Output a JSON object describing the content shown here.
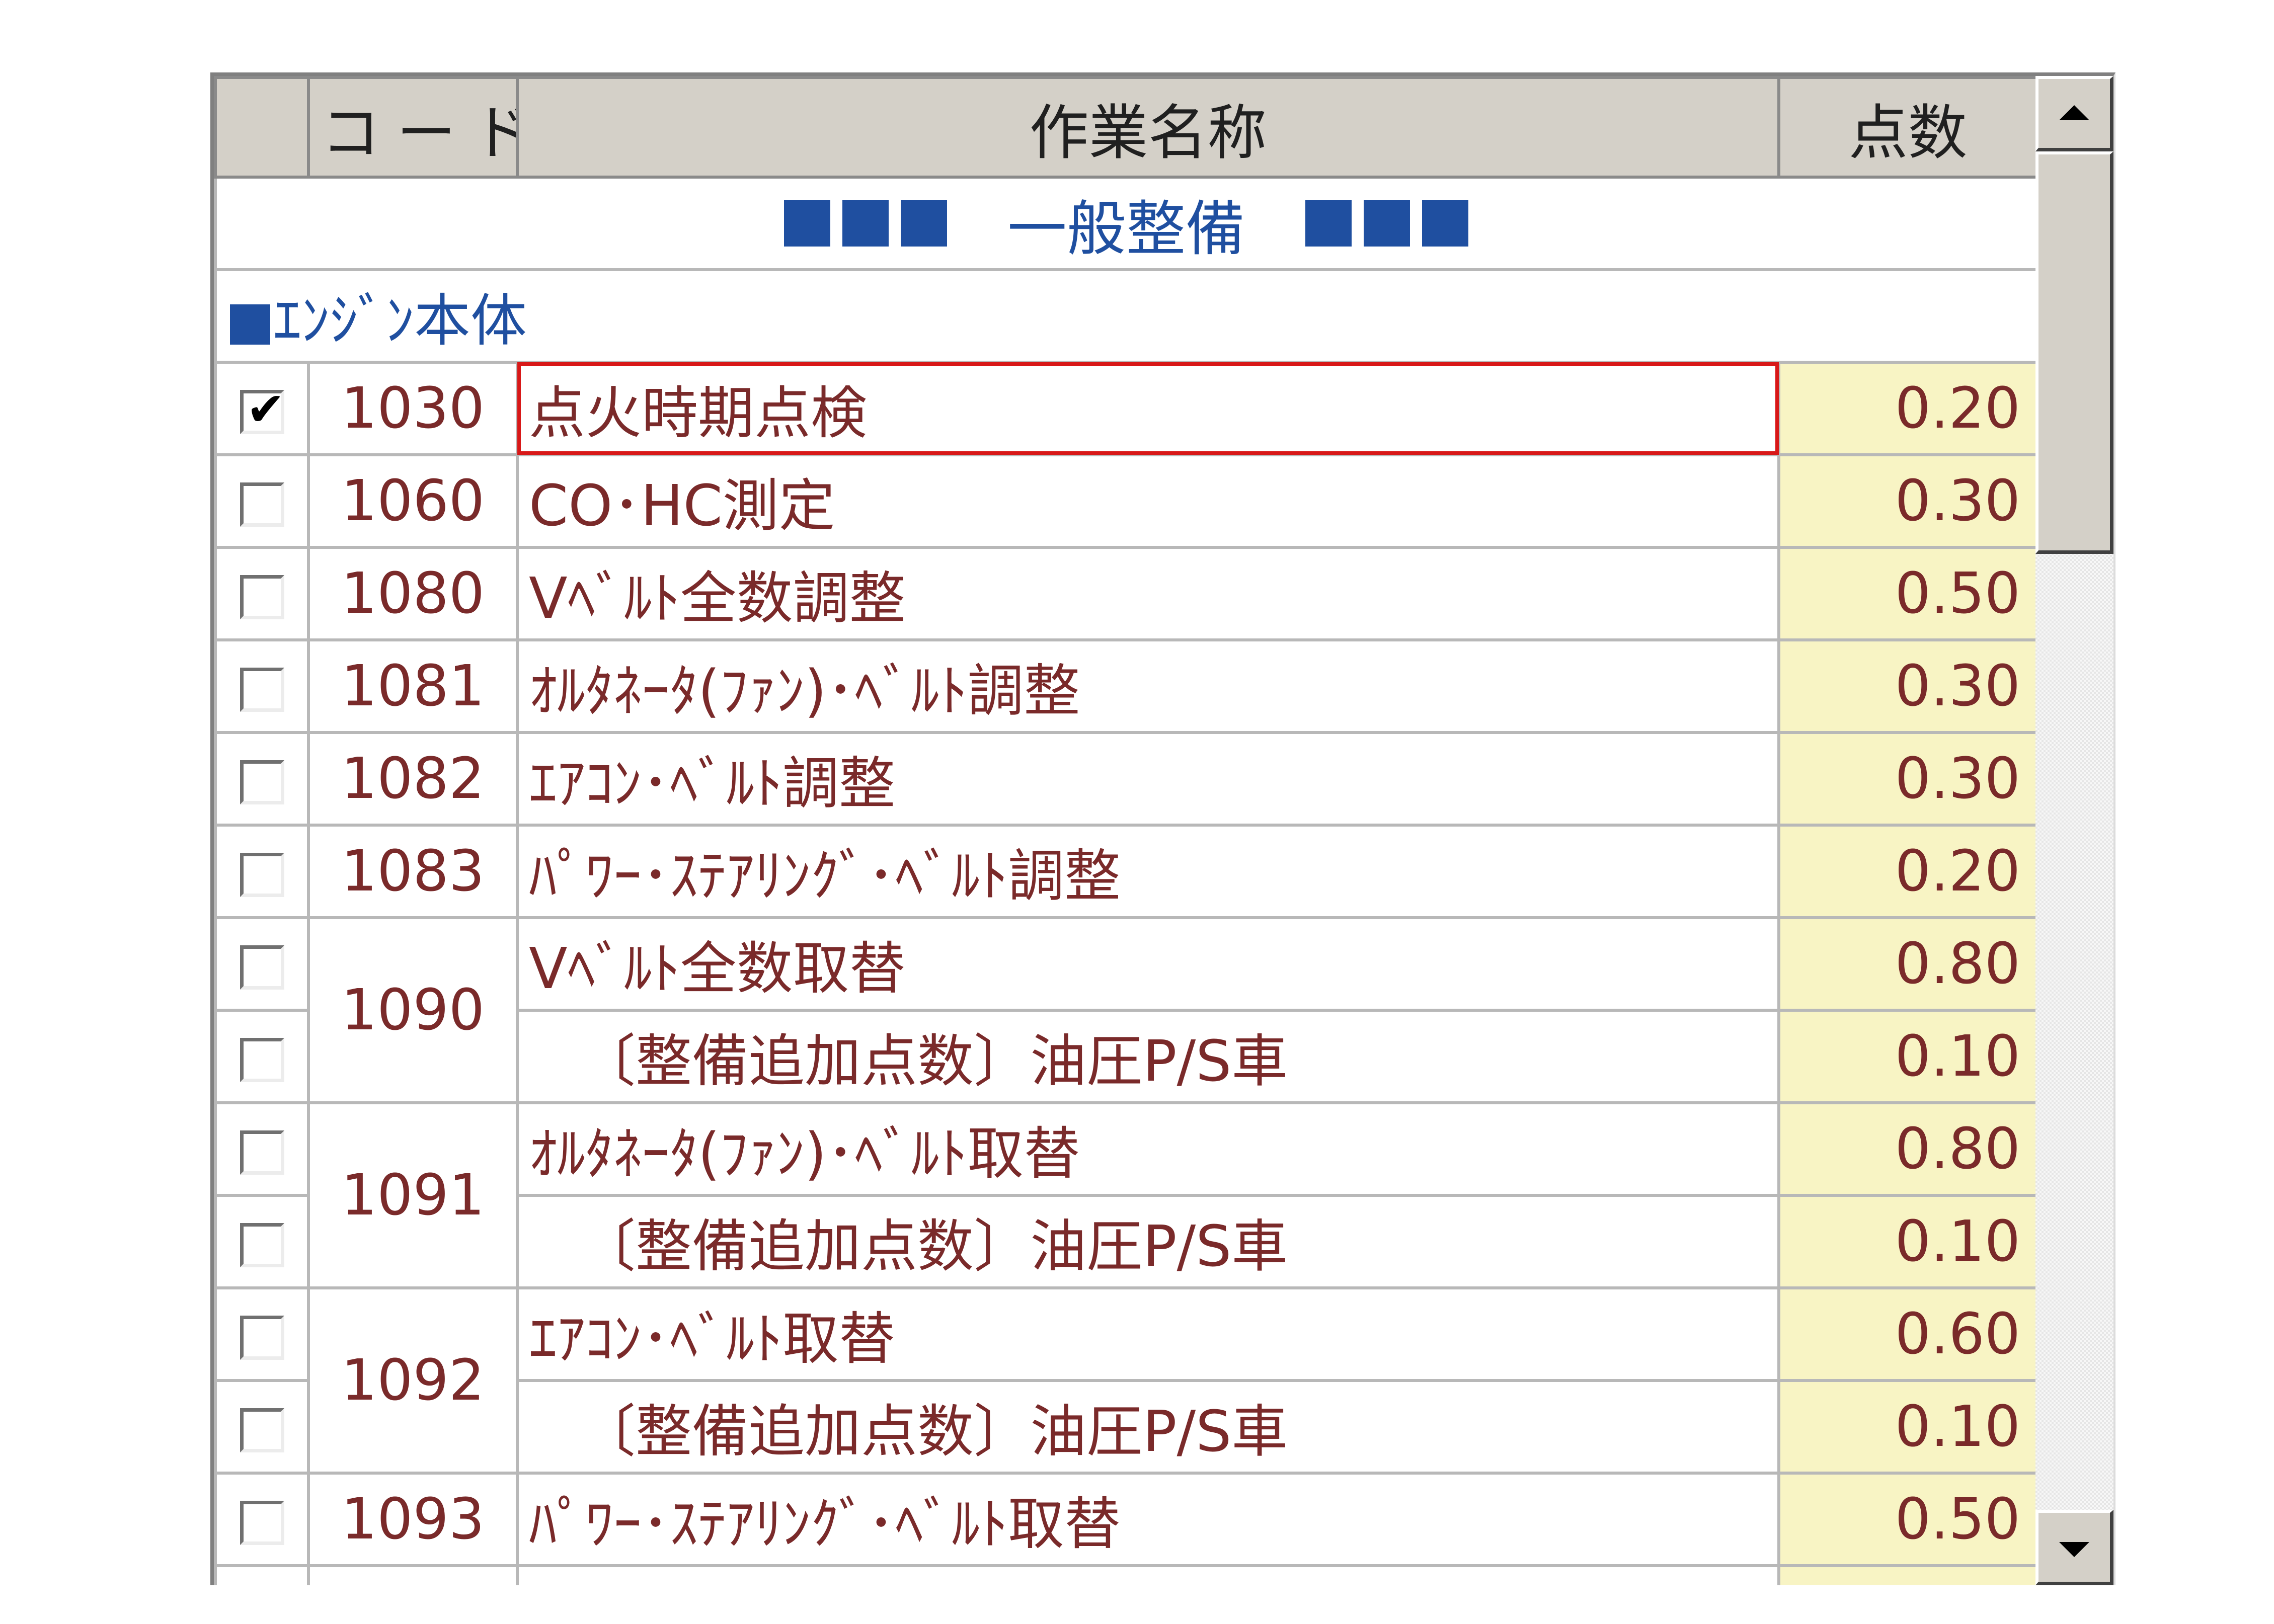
{
  "columns": {
    "check": "",
    "code": "コード",
    "name": "作業名称",
    "points": "点数"
  },
  "banner": {
    "text": "一般整備"
  },
  "group": {
    "text": "ｴﾝｼﾞﾝ本体"
  },
  "rows": [
    {
      "checked": true,
      "code": "1030",
      "name": "点火時期点検",
      "points": "0.20"
    },
    {
      "checked": false,
      "code": "1060",
      "name": "CO･HC測定",
      "points": "0.30"
    },
    {
      "checked": false,
      "code": "1080",
      "name": "Vﾍﾞﾙﾄ全数調整",
      "points": "0.50"
    },
    {
      "checked": false,
      "code": "1081",
      "name": "ｵﾙﾀﾈｰﾀ(ﾌｧﾝ)･ﾍﾞﾙﾄ調整",
      "points": "0.30"
    },
    {
      "checked": false,
      "code": "1082",
      "name": "ｴｱｺﾝ･ﾍﾞﾙﾄ調整",
      "points": "0.30"
    },
    {
      "checked": false,
      "code": "1083",
      "name": "ﾊﾟﾜｰ･ｽﾃｱﾘﾝｸﾞ･ﾍﾞﾙﾄ調整",
      "points": "0.20"
    },
    {
      "checked": false,
      "code": "1090",
      "name": "Vﾍﾞﾙﾄ全数取替",
      "points": "0.80"
    },
    {
      "checked": false,
      "code": "",
      "name": "〔整備追加点数〕油圧P/S車",
      "points": "0.10"
    },
    {
      "checked": false,
      "code": "1091",
      "name": "ｵﾙﾀﾈｰﾀ(ﾌｧﾝ)･ﾍﾞﾙﾄ取替",
      "points": "0.80"
    },
    {
      "checked": false,
      "code": "",
      "name": "〔整備追加点数〕油圧P/S車",
      "points": "0.10"
    },
    {
      "checked": false,
      "code": "1092",
      "name": "ｴｱｺﾝ･ﾍﾞﾙﾄ取替",
      "points": "0.60"
    },
    {
      "checked": false,
      "code": "",
      "name": "〔整備追加点数〕油圧P/S車",
      "points": "0.10"
    },
    {
      "checked": false,
      "code": "1093",
      "name": "ﾊﾟﾜｰ･ｽﾃｱﾘﾝｸﾞ･ﾍﾞﾙﾄ取替",
      "points": "0.50"
    }
  ],
  "check_glyph": "✔",
  "icons": {
    "scroll_up": "arrow-up-icon",
    "scroll_down": "arrow-down-icon"
  },
  "colors": {
    "header_bg": "#d4d0c8",
    "section_text": "#1f4fa0",
    "row_text": "#7a2a2a",
    "points_bg": "#f8f4c4",
    "selection_border": "#d81818"
  }
}
